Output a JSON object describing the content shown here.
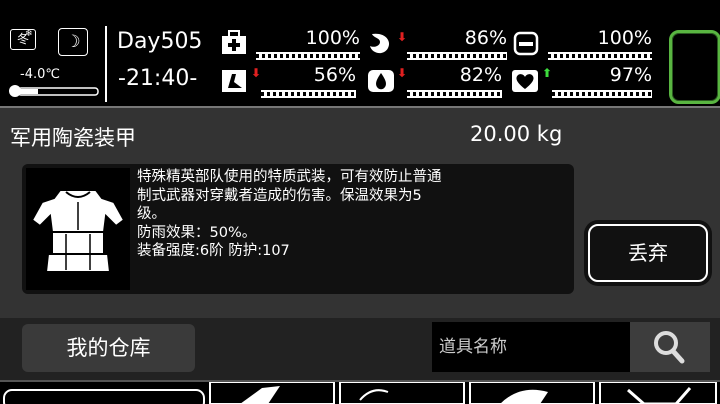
{
  "status": {
    "season": "冬",
    "temperature": "-4.0℃",
    "day": "Day505",
    "time": "-21:40-",
    "stats": [
      {
        "name": "health",
        "value": "100%"
      },
      {
        "name": "hunger",
        "value": "86%"
      },
      {
        "name": "battery",
        "value": "100%"
      },
      {
        "name": "stamina",
        "value": "56%"
      },
      {
        "name": "thirst",
        "value": "82%"
      },
      {
        "name": "mood",
        "value": "97%"
      }
    ]
  },
  "item": {
    "name": "军用陶瓷装甲",
    "weight": "20.00 kg",
    "description_lines": [
      "特殊精英部队使用的特质武装，可有效防止普通",
      "制式武器对穿戴者造成的伤害。保温效果为5",
      "级。",
      "防雨效果：50%。",
      "装备强度:6阶 防护:107"
    ],
    "discard_label": "丢弃"
  },
  "warehouse": {
    "label": "我的仓库",
    "search_placeholder": "道具名称"
  },
  "colors": {
    "slot_border": "#59b541",
    "arrow_up": "#3ddc3d",
    "arrow_down": "#e02020"
  },
  "icons": [
    "snow-icon",
    "moon-icon",
    "thermometer-icon",
    "medkit-icon",
    "stomach-icon",
    "battery-icon",
    "walking-icon",
    "water-drop-icon",
    "heart-icon",
    "search-icon"
  ]
}
